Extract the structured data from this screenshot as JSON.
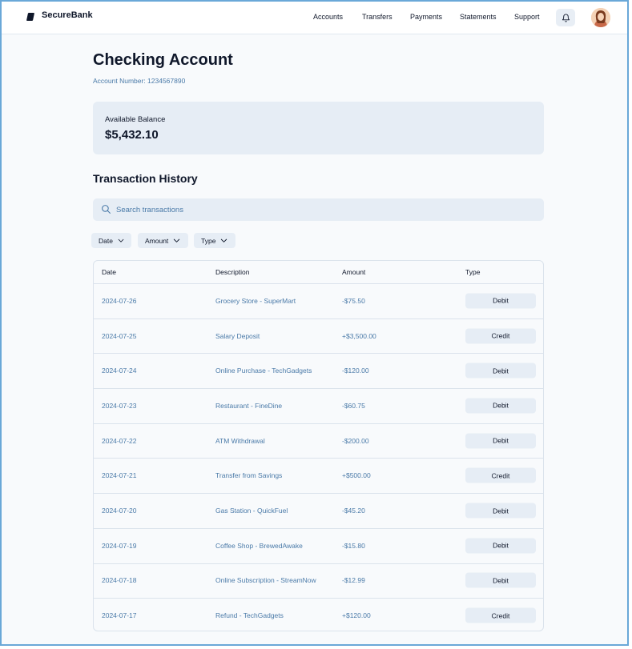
{
  "app": {
    "brand": "SecureBank",
    "nav": [
      "Accounts",
      "Transfers",
      "Payments",
      "Statements",
      "Support"
    ]
  },
  "page": {
    "title": "Checking Account",
    "account_number": "Account Number: 1234567890"
  },
  "balance": {
    "label": "Available Balance",
    "value": "$5,432.10"
  },
  "history": {
    "title": "Transaction History",
    "search_placeholder": "Search transactions",
    "filters": [
      "Date",
      "Amount",
      "Type"
    ],
    "columns": [
      "Date",
      "Description",
      "Amount",
      "Type"
    ],
    "rows": [
      {
        "date": "2024-07-26",
        "description": "Grocery Store - SuperMart",
        "amount": "-$75.50",
        "type": "Debit"
      },
      {
        "date": "2024-07-25",
        "description": "Salary Deposit",
        "amount": "+$3,500.00",
        "type": "Credit"
      },
      {
        "date": "2024-07-24",
        "description": "Online Purchase - TechGadgets",
        "amount": "-$120.00",
        "type": "Debit"
      },
      {
        "date": "2024-07-23",
        "description": "Restaurant - FineDine",
        "amount": "-$60.75",
        "type": "Debit"
      },
      {
        "date": "2024-07-22",
        "description": "ATM Withdrawal",
        "amount": "-$200.00",
        "type": "Debit"
      },
      {
        "date": "2024-07-21",
        "description": "Transfer from Savings",
        "amount": "+$500.00",
        "type": "Credit"
      },
      {
        "date": "2024-07-20",
        "description": "Gas Station - QuickFuel",
        "amount": "-$45.20",
        "type": "Debit"
      },
      {
        "date": "2024-07-19",
        "description": "Coffee Shop - BrewedAwake",
        "amount": "-$15.80",
        "type": "Debit"
      },
      {
        "date": "2024-07-18",
        "description": "Online Subscription - StreamNow",
        "amount": "-$12.99",
        "type": "Debit"
      },
      {
        "date": "2024-07-17",
        "description": "Refund - TechGadgets",
        "amount": "+$120.00",
        "type": "Credit"
      }
    ]
  },
  "icons": {
    "logo": "securebank-logo-icon",
    "bell": "bell-icon",
    "search": "search-icon",
    "chevron": "chevron-down-icon"
  },
  "colors": {
    "primary_text": "#0f172a",
    "muted_blue": "#4a7aa8",
    "surface": "#e6edf5",
    "border": "#dbe3ec",
    "frame": "#6aa8d8"
  }
}
